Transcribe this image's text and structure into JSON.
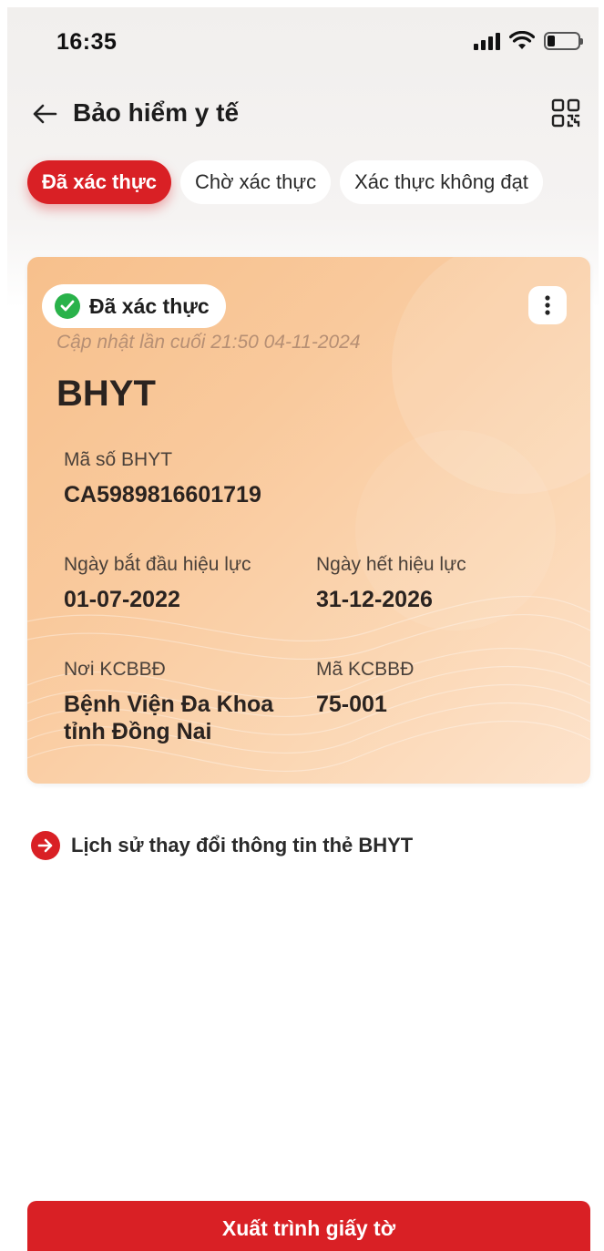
{
  "status_bar": {
    "time": "16:35",
    "battery_level": 0.25,
    "icons": [
      "signal-icon",
      "wifi-icon",
      "battery-icon"
    ]
  },
  "header": {
    "title": "Bảo hiểm y tế",
    "back_icon": "arrow-left-icon",
    "qr_icon": "qr-scan-icon"
  },
  "tabs": [
    {
      "label": "Đã xác thực",
      "active": true
    },
    {
      "label": "Chờ xác thực",
      "active": false
    },
    {
      "label": "Xác thực không đạt",
      "active": false
    }
  ],
  "card": {
    "badge_label": "Đã xác thực",
    "badge_icon": "check-circle-icon",
    "more_icon": "more-vertical-icon",
    "updated": "Cập nhật lần cuối 21:50 04-11-2024",
    "title": "BHYT",
    "fields": {
      "card_number": {
        "label": "Mã số BHYT",
        "value": "CA5989816601719"
      },
      "start_date": {
        "label": "Ngày bắt đầu hiệu lực",
        "value": "01-07-2022"
      },
      "end_date": {
        "label": "Ngày hết hiệu lực",
        "value": "31-12-2026"
      },
      "facility": {
        "label": "Nơi KCBBĐ",
        "value_line1": "Bệnh Viện Đa Khoa",
        "value_line2": "tỉnh Đồng Nai"
      },
      "facility_code": {
        "label": "Mã KCBBĐ",
        "value": "75-001"
      }
    }
  },
  "history_link": {
    "label": "Lịch sử thay đổi thông tin thẻ BHYT",
    "icon": "arrow-right-circle-icon"
  },
  "present_button": {
    "label": "Xuất trình giấy tờ"
  },
  "colors": {
    "accent": "#d92025",
    "verified_green": "#29b24a",
    "card_gradient_start": "#f7c08c",
    "card_gradient_end": "#fde3cc"
  }
}
